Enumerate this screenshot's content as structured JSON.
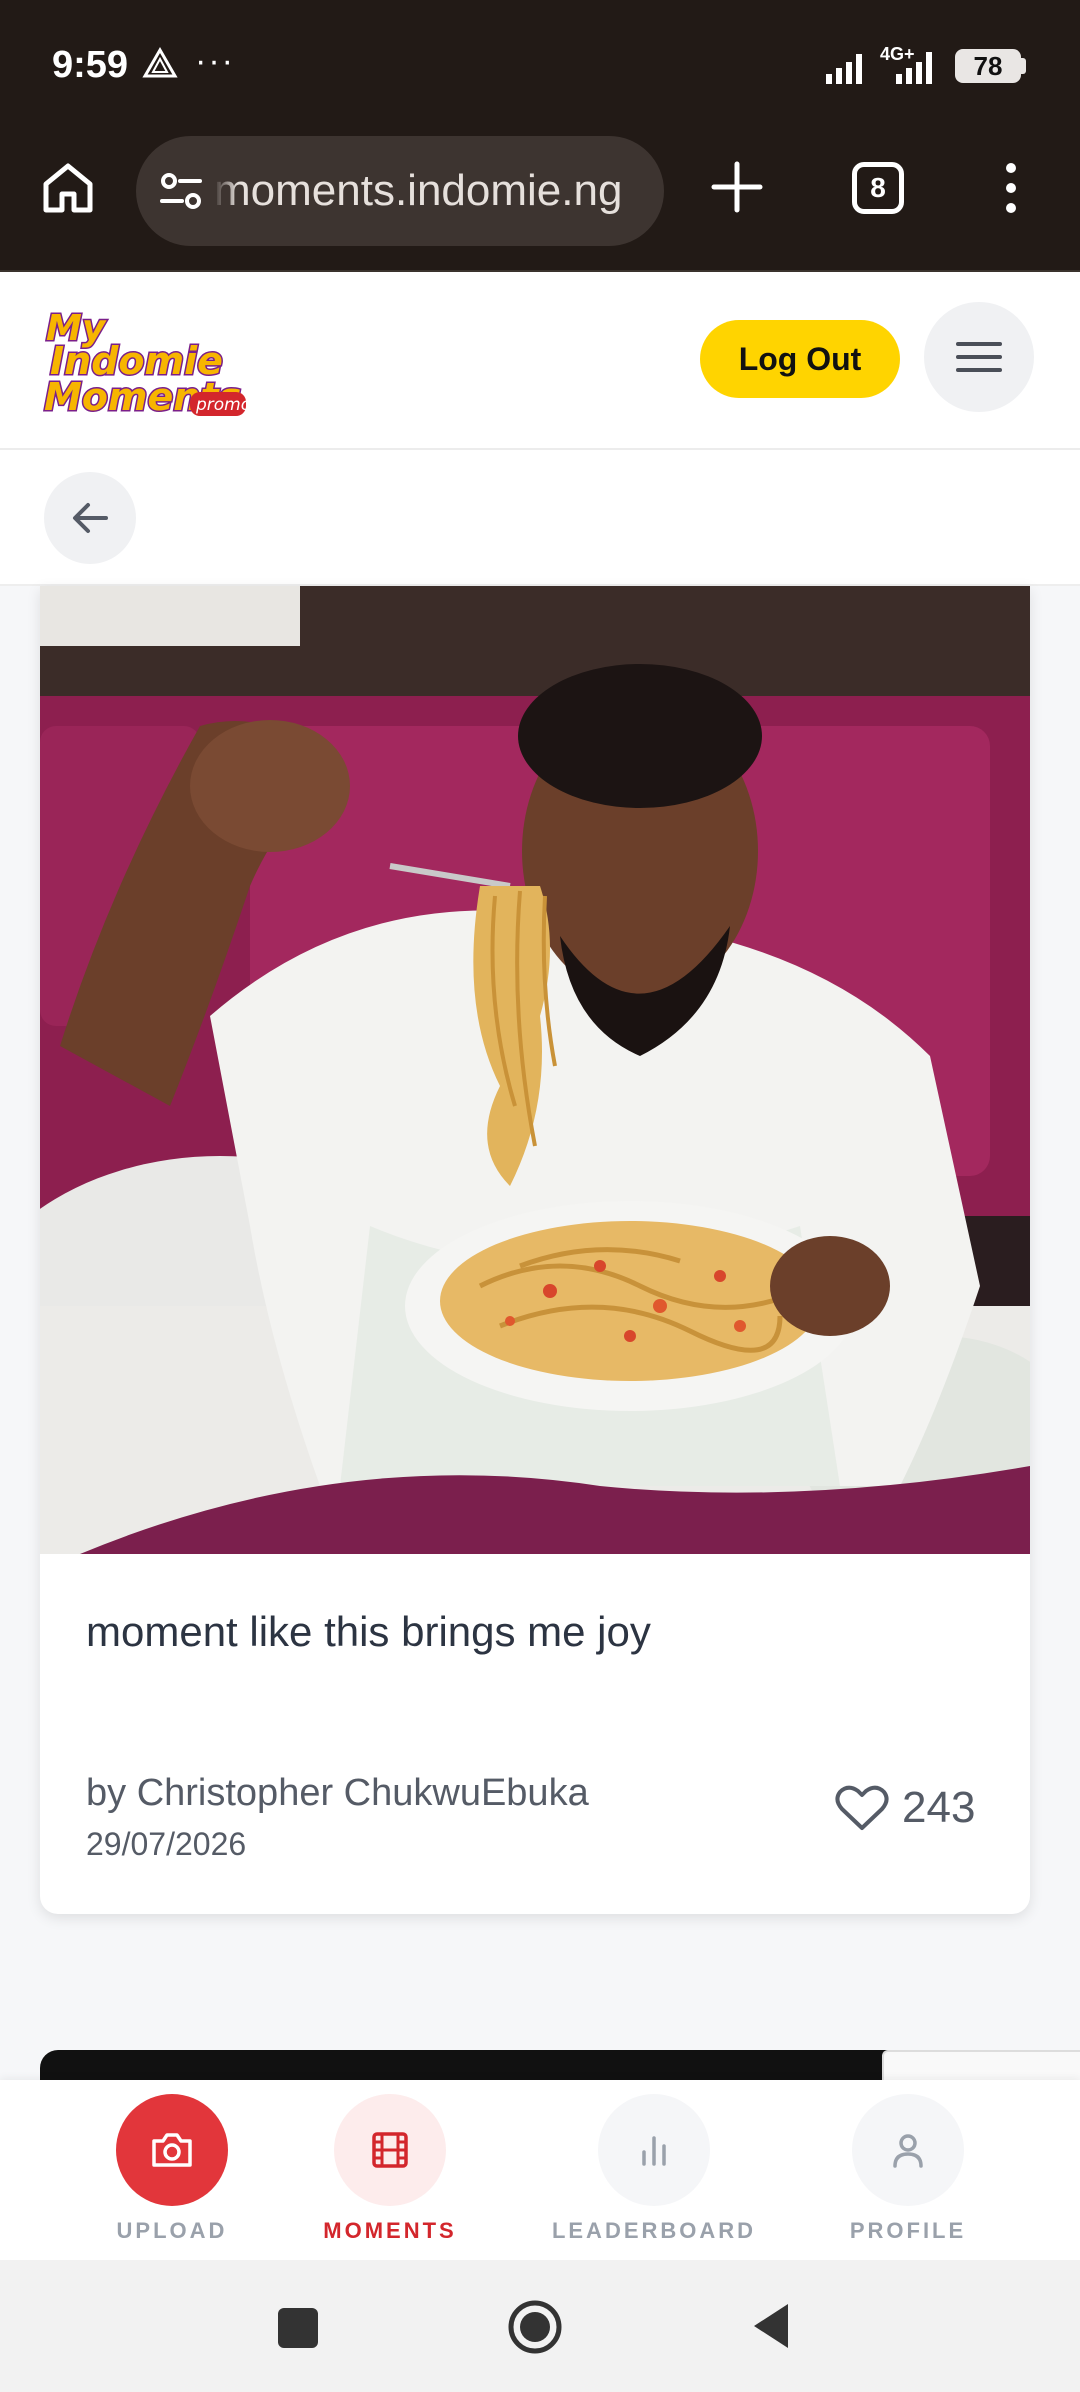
{
  "status_bar": {
    "time": "9:59",
    "more": "···",
    "network": "4G+",
    "battery": "78"
  },
  "browser": {
    "url": "moments.indomie.ng",
    "tab_count": "8"
  },
  "header": {
    "logo_alt": "My Indomie Moments promo",
    "logout_label": "Log Out"
  },
  "moment": {
    "caption": "moment like this brings me joy",
    "author": "by Christopher ChukwuEbuka",
    "date": "29/07/2026",
    "likes": "243"
  },
  "bottom_nav": {
    "upload_label": "UPLOAD",
    "moments_label": "MOMENTS",
    "leaderboard_label": "LEADERBOARD",
    "profile_label": "PROFILE",
    "active": "moments"
  },
  "colors": {
    "accent_red": "#e2363b",
    "logout_yellow": "#ffd400",
    "chrome_dark": "#221a16"
  }
}
